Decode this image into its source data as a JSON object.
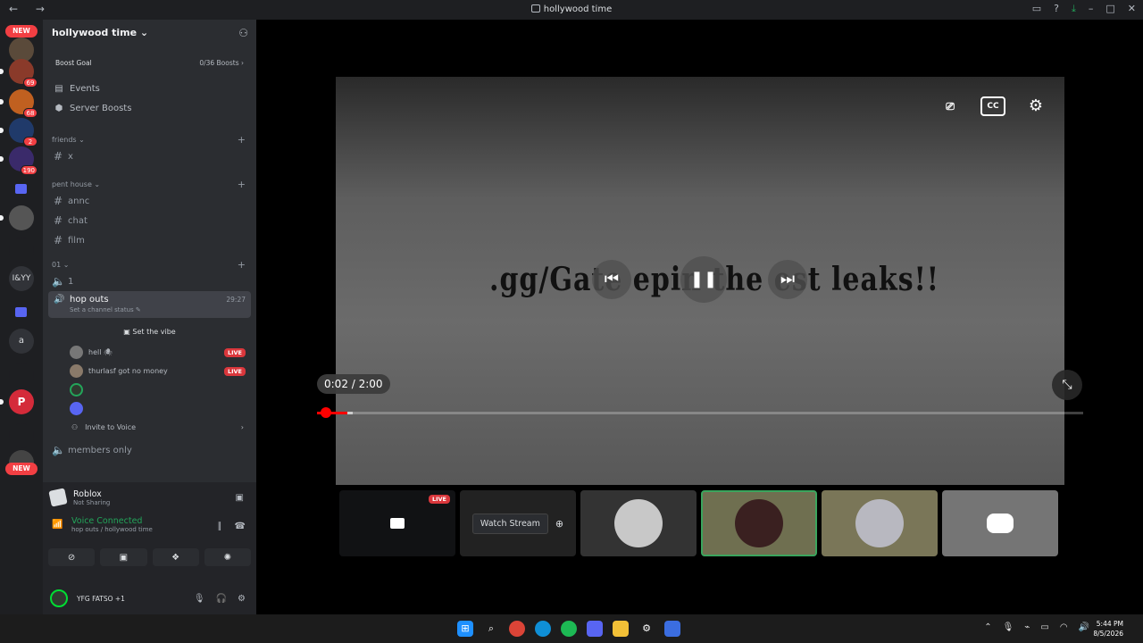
{
  "window": {
    "title": "hollywood time",
    "nav": "← →"
  },
  "server": {
    "name": "hollywood time ⌄",
    "boost_goal": "Boost Goal",
    "boost_count": "0/36 Boosts ›"
  },
  "guilds": {
    "new_top": "NEW",
    "new_bottom": "NEW",
    "badges": [
      "69",
      "68",
      "2",
      "190"
    ],
    "text_icons": [
      "I&YY",
      "a"
    ]
  },
  "sidebar": {
    "items": [
      {
        "icon": "calendar-icon",
        "label": "Events"
      },
      {
        "icon": "boost-icon",
        "label": "Server Boosts"
      }
    ],
    "categories": [
      {
        "name": "friends ⌄",
        "channels": [
          {
            "name": "x"
          }
        ]
      },
      {
        "name": "pent house ⌄",
        "channels": [
          {
            "name": "annc"
          },
          {
            "name": "chat"
          },
          {
            "name": "film"
          }
        ]
      },
      {
        "name": "01 ⌄",
        "channels": [
          {
            "name": "1"
          }
        ]
      }
    ],
    "active_voice": {
      "name": "hop outs",
      "status": "Set a channel status ✎",
      "time": "29:27",
      "vibe": "Set the vibe",
      "users": [
        {
          "name": "hell 🕷",
          "live": "LIVE"
        },
        {
          "name": "thurlasf got no money",
          "live": "LIVE"
        },
        {
          "name": ""
        },
        {
          "name": ""
        }
      ],
      "invite": "Invite to Voice"
    },
    "members_only": "members only"
  },
  "panel": {
    "activity_title": "Roblox",
    "activity_sub": "Not Sharing",
    "voice_title": "Voice Connected",
    "voice_sub": "hop outs / hollywood time",
    "user": "YFG FATSO +1"
  },
  "player": {
    "overlay_text": ".gg/Gate    epin    the   est  leaks!!",
    "time": "0:02 / 2:00",
    "progress_fraction": 0.017,
    "cc_label": "CC"
  },
  "tiles": {
    "live": "LIVE",
    "watch_stream": "Watch Stream"
  },
  "taskbar": {
    "time": "5:44 PM",
    "date": "8/5/2026"
  }
}
